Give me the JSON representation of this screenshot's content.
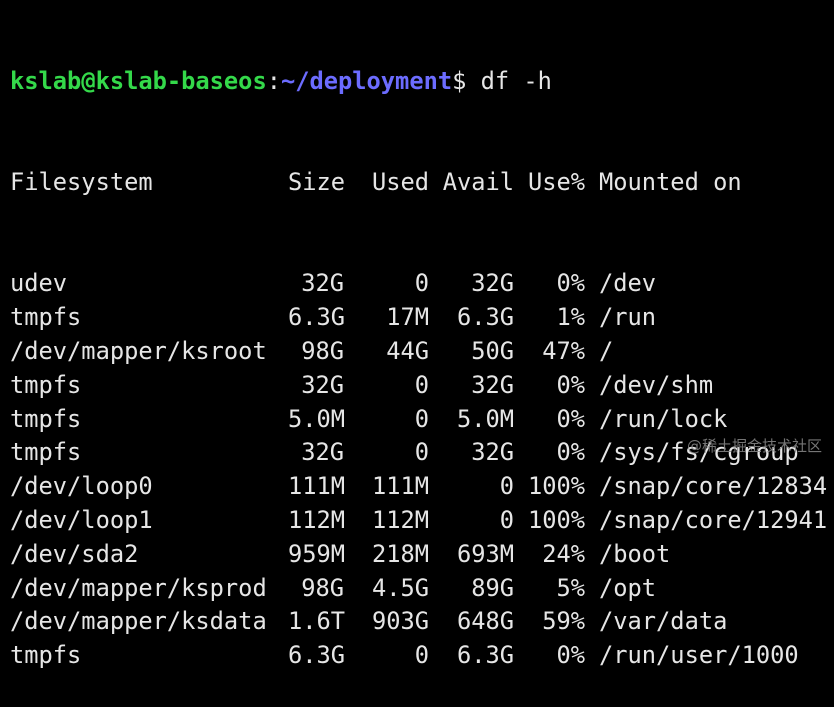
{
  "prompt": {
    "user_host": "kslab@kslab-baseos",
    "separator": ":",
    "path": "~/deployment",
    "symbol": "$",
    "command": "df -h"
  },
  "table": {
    "headers": [
      "Filesystem",
      "Size",
      "Used",
      "Avail",
      "Use%",
      "Mounted on"
    ],
    "rows": [
      [
        "udev",
        "32G",
        "0",
        "32G",
        "0%",
        "/dev"
      ],
      [
        "tmpfs",
        "6.3G",
        "17M",
        "6.3G",
        "1%",
        "/run"
      ],
      [
        "/dev/mapper/ksroot",
        "98G",
        "44G",
        "50G",
        "47%",
        "/"
      ],
      [
        "tmpfs",
        "32G",
        "0",
        "32G",
        "0%",
        "/dev/shm"
      ],
      [
        "tmpfs",
        "5.0M",
        "0",
        "5.0M",
        "0%",
        "/run/lock"
      ],
      [
        "tmpfs",
        "32G",
        "0",
        "32G",
        "0%",
        "/sys/fs/cgroup"
      ],
      [
        "/dev/loop0",
        "111M",
        "111M",
        "0",
        "100%",
        "/snap/core/12834"
      ],
      [
        "/dev/loop1",
        "112M",
        "112M",
        "0",
        "100%",
        "/snap/core/12941"
      ],
      [
        "/dev/sda2",
        "959M",
        "218M",
        "693M",
        "24%",
        "/boot"
      ],
      [
        "/dev/mapper/ksprod",
        "98G",
        "4.5G",
        "89G",
        "5%",
        "/opt"
      ],
      [
        "/dev/mapper/ksdata",
        "1.6T",
        "903G",
        "648G",
        "59%",
        "/var/data"
      ],
      [
        "tmpfs",
        "6.3G",
        "0",
        "6.3G",
        "0%",
        "/run/user/1000"
      ]
    ]
  },
  "watermark": "@稀土掘金技术社区",
  "colors": {
    "background": "#000000",
    "text": "#e6e6e6",
    "prompt_user": "#34d94a",
    "prompt_path": "#6c6cff"
  }
}
